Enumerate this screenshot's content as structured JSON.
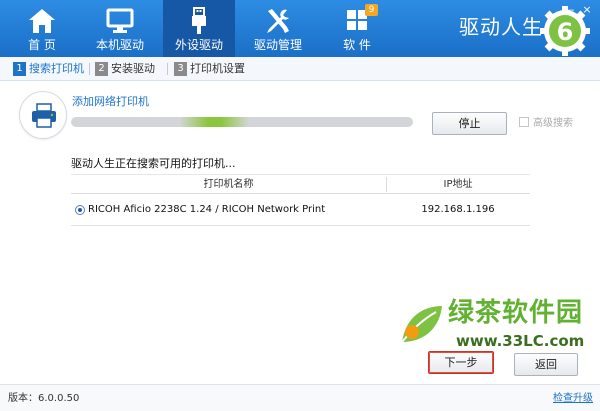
{
  "nav": {
    "items": [
      {
        "label": "首 页",
        "icon": "home-icon"
      },
      {
        "label": "本机驱动",
        "icon": "monitor-icon"
      },
      {
        "label": "外设驱动",
        "icon": "usb-icon"
      },
      {
        "label": "驱动管理",
        "icon": "tools-icon"
      },
      {
        "label": "软 件",
        "icon": "apps-grid-icon",
        "badge": "9"
      }
    ],
    "active": "外设驱动",
    "brand": "驱动人生",
    "logo_digit": "6"
  },
  "window": {
    "minimize": "—",
    "close": "×"
  },
  "steps": [
    {
      "num": "1",
      "label": "搜索打印机",
      "active": true
    },
    {
      "num": "2",
      "label": "安装驱动",
      "active": false
    },
    {
      "num": "3",
      "label": "打印机设置",
      "active": false
    }
  ],
  "search": {
    "add_network_printer": "添加网络打印机",
    "progress_window": {
      "start": 0.32,
      "end": 0.52
    },
    "stop_label": "停止",
    "advanced_search_label": "高级搜索",
    "advanced_search_checked": false,
    "status_text": "驱动人生正在搜索可用的打印机..."
  },
  "table": {
    "columns": [
      "打印机名称",
      "IP地址"
    ],
    "rows": [
      {
        "name": "RICOH Aficio 2238C 1.24 / RICOH Network Print",
        "ip": "192.168.1.196",
        "selected": true
      }
    ]
  },
  "watermark": {
    "text": "绿茶软件园",
    "url": "www.33LC.com"
  },
  "buttons": {
    "next": "下一步",
    "back": "返回"
  },
  "footer": {
    "version": "版本：6.0.0.50",
    "check_update": "检查升级"
  },
  "colors": {
    "nav_bg": "#1b6fc7",
    "nav_active": "#1658a6",
    "accent": "#1e73c9",
    "progress": "#8cc63f",
    "watermark_green": "#62b132"
  }
}
